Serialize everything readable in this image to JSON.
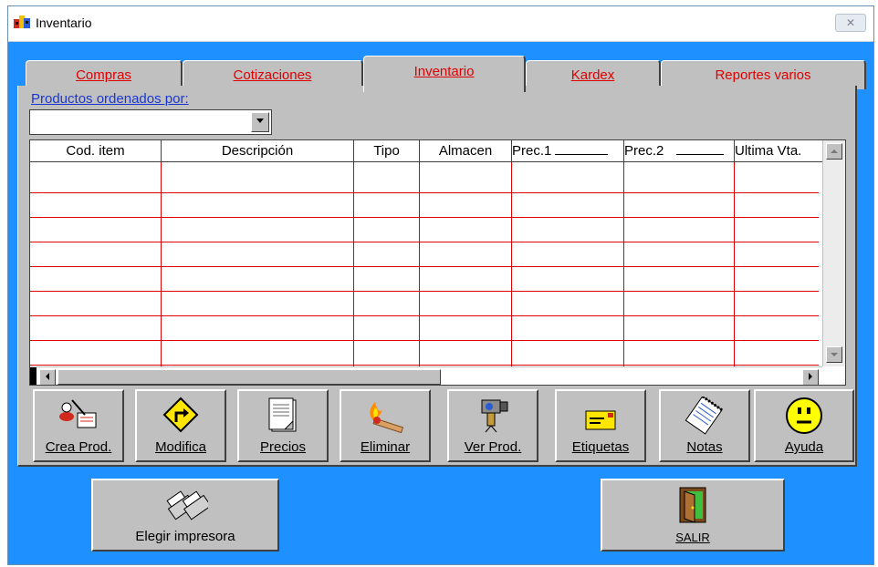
{
  "window": {
    "title": "Inventario",
    "close_glyph": "✕"
  },
  "tabs": [
    {
      "label": "Compras",
      "active": false
    },
    {
      "label": "Cotizaciones",
      "active": false
    },
    {
      "label": "Inventario",
      "active": true
    },
    {
      "label": "Kardex",
      "active": false
    },
    {
      "label": "Reportes varios",
      "active": false
    }
  ],
  "sort": {
    "label": "Productos ordenados por:",
    "value": ""
  },
  "grid": {
    "columns": [
      "Cod. item",
      "Descripción",
      "Tipo",
      "Almacen",
      "Prec.1",
      "Prec.2",
      "Ultima Vta."
    ],
    "line_color": "#e00000"
  },
  "toolbar": [
    {
      "name": "crea-prod",
      "label": "Crea Prod.",
      "icon": "user-pen-icon"
    },
    {
      "name": "modifica",
      "label": "Modifica",
      "icon": "turn-sign-icon"
    },
    {
      "name": "precios",
      "label": "Precios",
      "icon": "document-stack-icon"
    },
    {
      "name": "eliminar",
      "label": "Eliminar",
      "icon": "match-fire-icon"
    },
    {
      "name": "ver-prod",
      "label": "Ver Prod.",
      "icon": "camera-icon"
    },
    {
      "name": "etiquetas",
      "label": "Etiquetas",
      "icon": "envelope-icon"
    },
    {
      "name": "notas",
      "label": "Notas",
      "icon": "notepad-icon"
    },
    {
      "name": "ayuda",
      "label": "Ayuda",
      "icon": "smiley-icon"
    }
  ],
  "footer": {
    "printer_label": "Elegir impresora",
    "exit_label": "SALIR"
  },
  "colors": {
    "window_bg": "#1e90ff",
    "panel": "#c0c0c0",
    "tab_text": "#e00000",
    "link": "#1a37d0"
  }
}
